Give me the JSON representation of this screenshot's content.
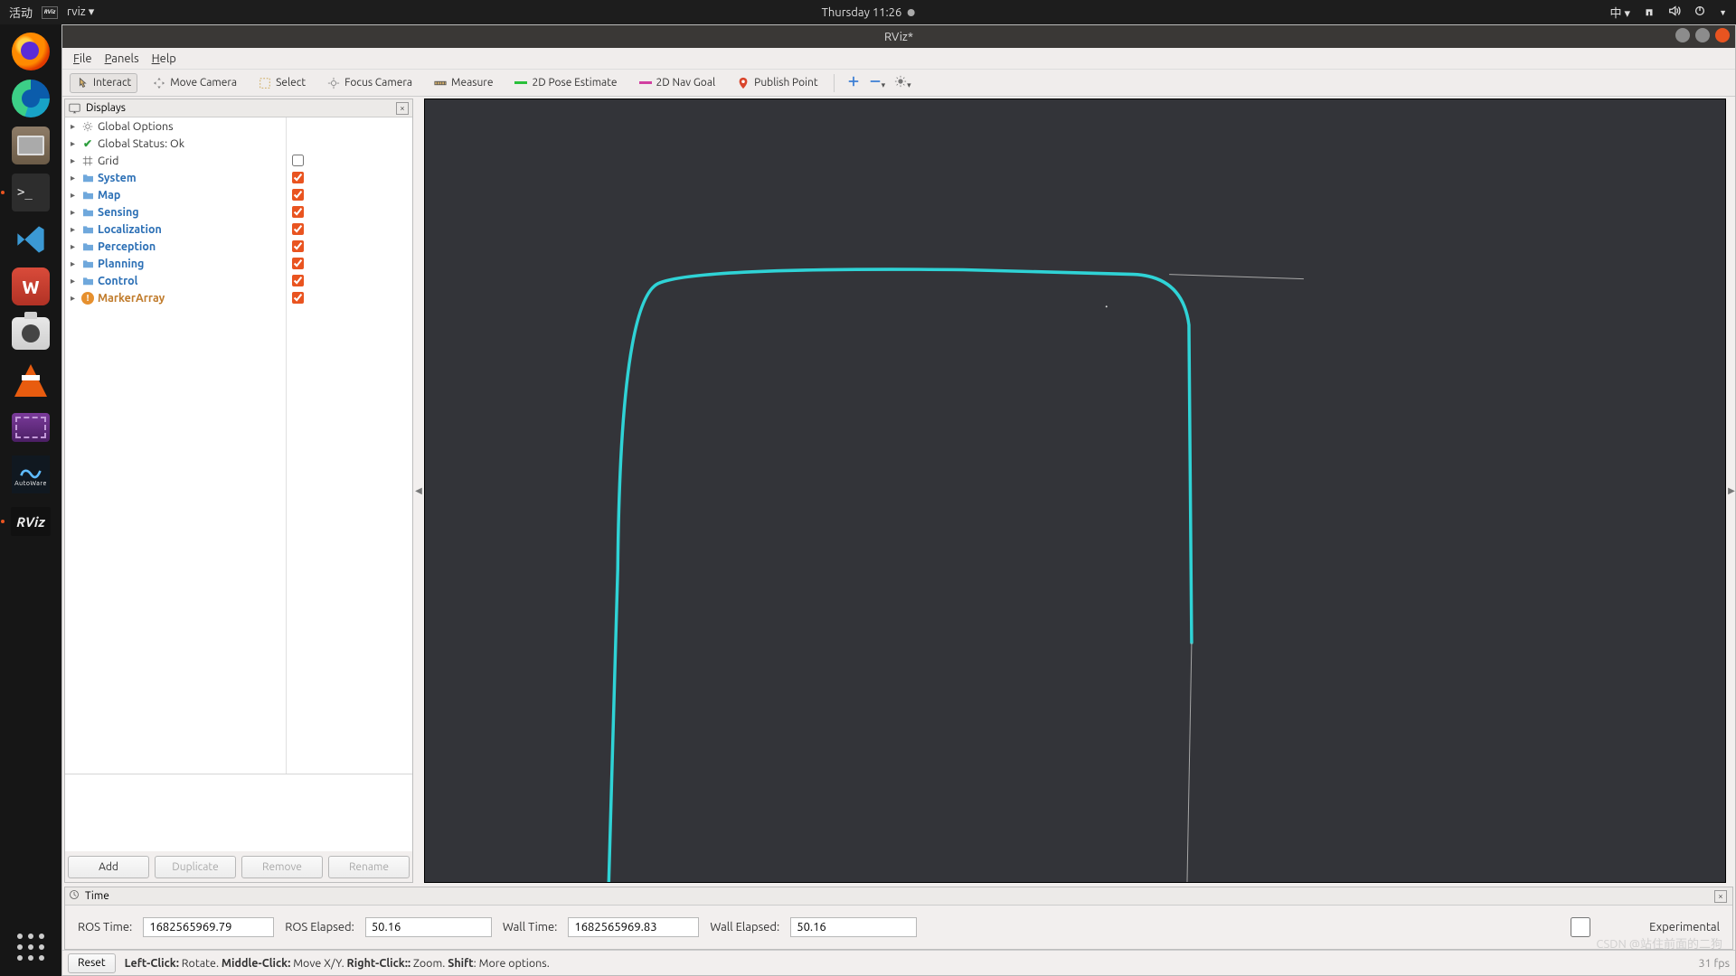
{
  "topbar": {
    "activities": "活动",
    "app_label": "rviz",
    "clock": "Thursday 11:26",
    "ime": "中"
  },
  "dock": {
    "items": [
      {
        "name": "firefox"
      },
      {
        "name": "edge"
      },
      {
        "name": "files"
      },
      {
        "name": "terminal"
      },
      {
        "name": "vscode"
      },
      {
        "name": "wps"
      },
      {
        "name": "camera"
      },
      {
        "name": "vlc"
      },
      {
        "name": "media"
      },
      {
        "name": "autoware"
      },
      {
        "name": "rviz"
      }
    ],
    "autoware_label": "AutoWare"
  },
  "window": {
    "title": "RViz*"
  },
  "menubar": {
    "file": "File",
    "panels": "Panels",
    "help": "Help"
  },
  "toolbar": {
    "interact": "Interact",
    "move_camera": "Move Camera",
    "select": "Select",
    "focus_camera": "Focus Camera",
    "measure": "Measure",
    "pose_estimate": "2D Pose Estimate",
    "nav_goal": "2D Nav Goal",
    "publish_point": "Publish Point"
  },
  "displays": {
    "title": "Displays",
    "items": [
      {
        "label": "Global Options",
        "kind": "gear",
        "check": null
      },
      {
        "label": "Global Status: Ok",
        "kind": "ok",
        "check": null
      },
      {
        "label": "Grid",
        "kind": "grid",
        "check": false
      },
      {
        "label": "System",
        "kind": "folder",
        "check": true
      },
      {
        "label": "Map",
        "kind": "folder",
        "check": true
      },
      {
        "label": "Sensing",
        "kind": "folder",
        "check": true
      },
      {
        "label": "Localization",
        "kind": "folder",
        "check": true
      },
      {
        "label": "Perception",
        "kind": "folder",
        "check": true
      },
      {
        "label": "Planning",
        "kind": "folder",
        "check": true
      },
      {
        "label": "Control",
        "kind": "folder",
        "check": true
      },
      {
        "label": "MarkerArray",
        "kind": "warn",
        "check": true
      }
    ],
    "buttons": {
      "add": "Add",
      "duplicate": "Duplicate",
      "remove": "Remove",
      "rename": "Rename"
    }
  },
  "time": {
    "title": "Time",
    "ros_time_label": "ROS Time:",
    "ros_time": "1682565969.79",
    "ros_elapsed_label": "ROS Elapsed:",
    "ros_elapsed": "50.16",
    "wall_time_label": "Wall Time:",
    "wall_time": "1682565969.83",
    "wall_elapsed_label": "Wall Elapsed:",
    "wall_elapsed": "50.16",
    "experimental": "Experimental"
  },
  "statusbar": {
    "reset": "Reset",
    "hints_html": "Left-Click: Rotate.  Middle-Click: Move X/Y.  Right-Click:: Zoom.  Shift: More options.",
    "hints": {
      "lc_b": "Left-Click:",
      "lc_t": " Rotate. ",
      "mc_b": "Middle-Click:",
      "mc_t": " Move X/Y. ",
      "rc_b": "Right-Click::",
      "rc_t": " Zoom. ",
      "sh_b": "Shift",
      "sh_t": ": More options."
    },
    "fps": "31 fps"
  },
  "watermark": "CSDN @站住前面的二狗"
}
